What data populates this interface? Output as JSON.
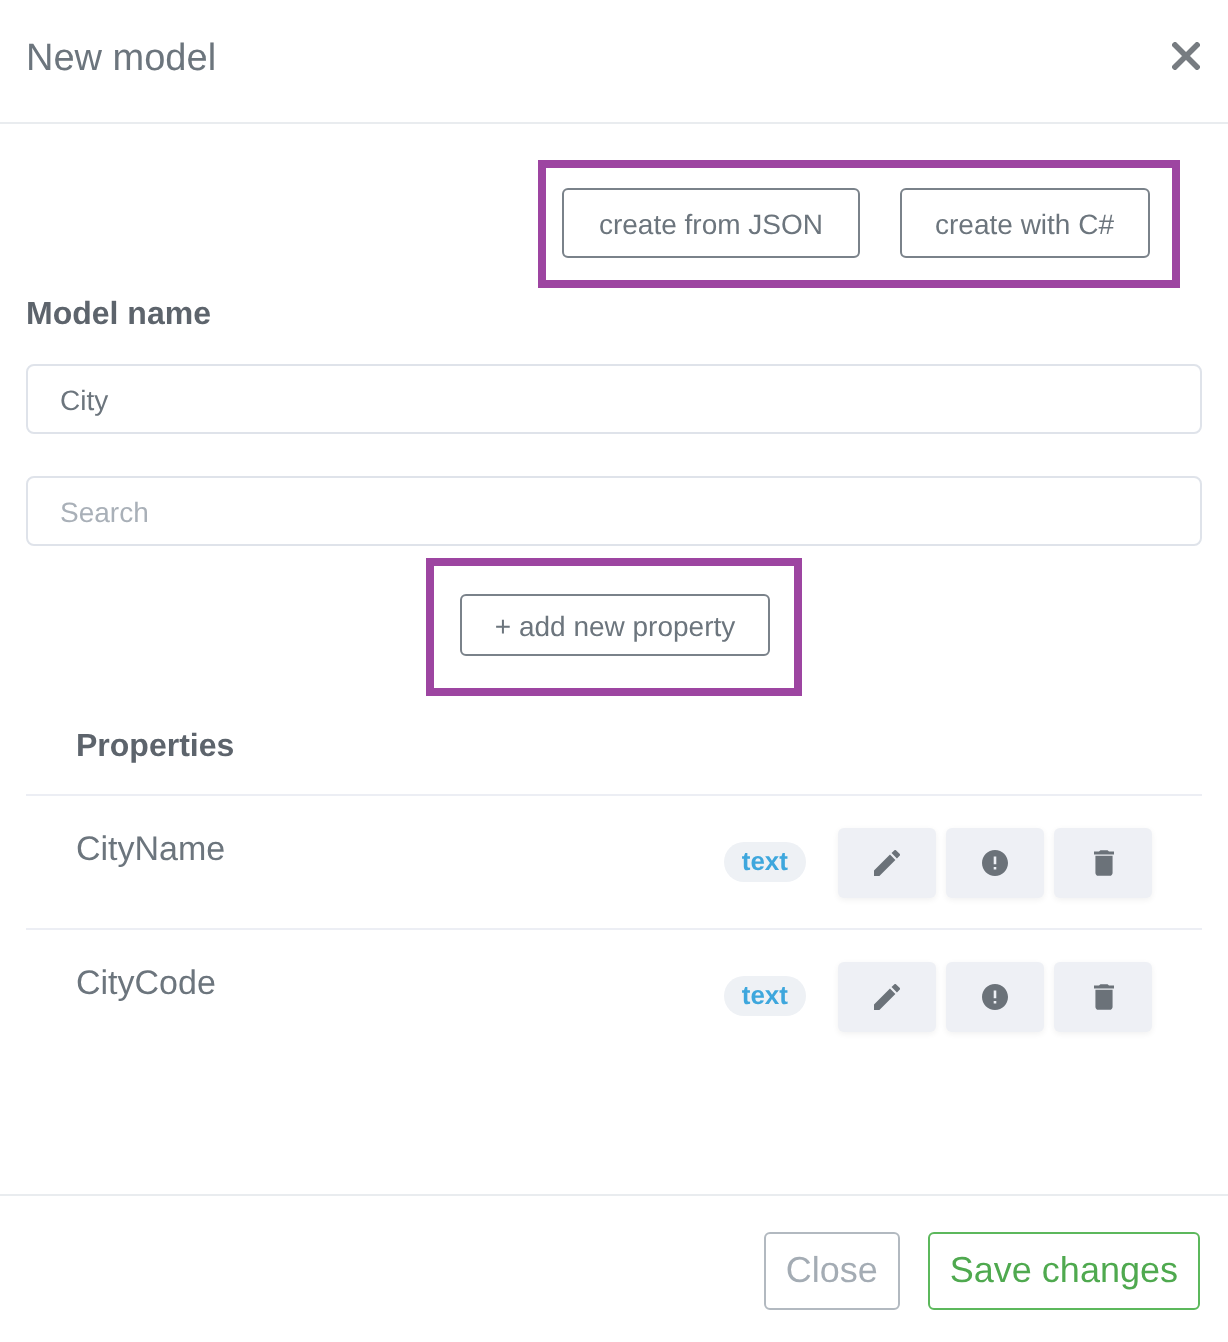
{
  "dialog": {
    "title": "New model"
  },
  "create_actions": {
    "highlighted": true,
    "buttons": [
      "create from JSON",
      "create with C#"
    ]
  },
  "model_name": {
    "label": "Model name",
    "value": "City"
  },
  "search": {
    "placeholder": "Search"
  },
  "add_property": {
    "label": "+ add new property",
    "highlighted": true
  },
  "properties": {
    "heading": "Properties",
    "rows": [
      {
        "name": "CityName",
        "type": "text"
      },
      {
        "name": "CityCode",
        "type": "text"
      }
    ]
  },
  "footer_buttons": [
    {
      "label": "Close",
      "kind": "secondary"
    },
    {
      "label": "Save changes",
      "kind": "success"
    }
  ]
}
